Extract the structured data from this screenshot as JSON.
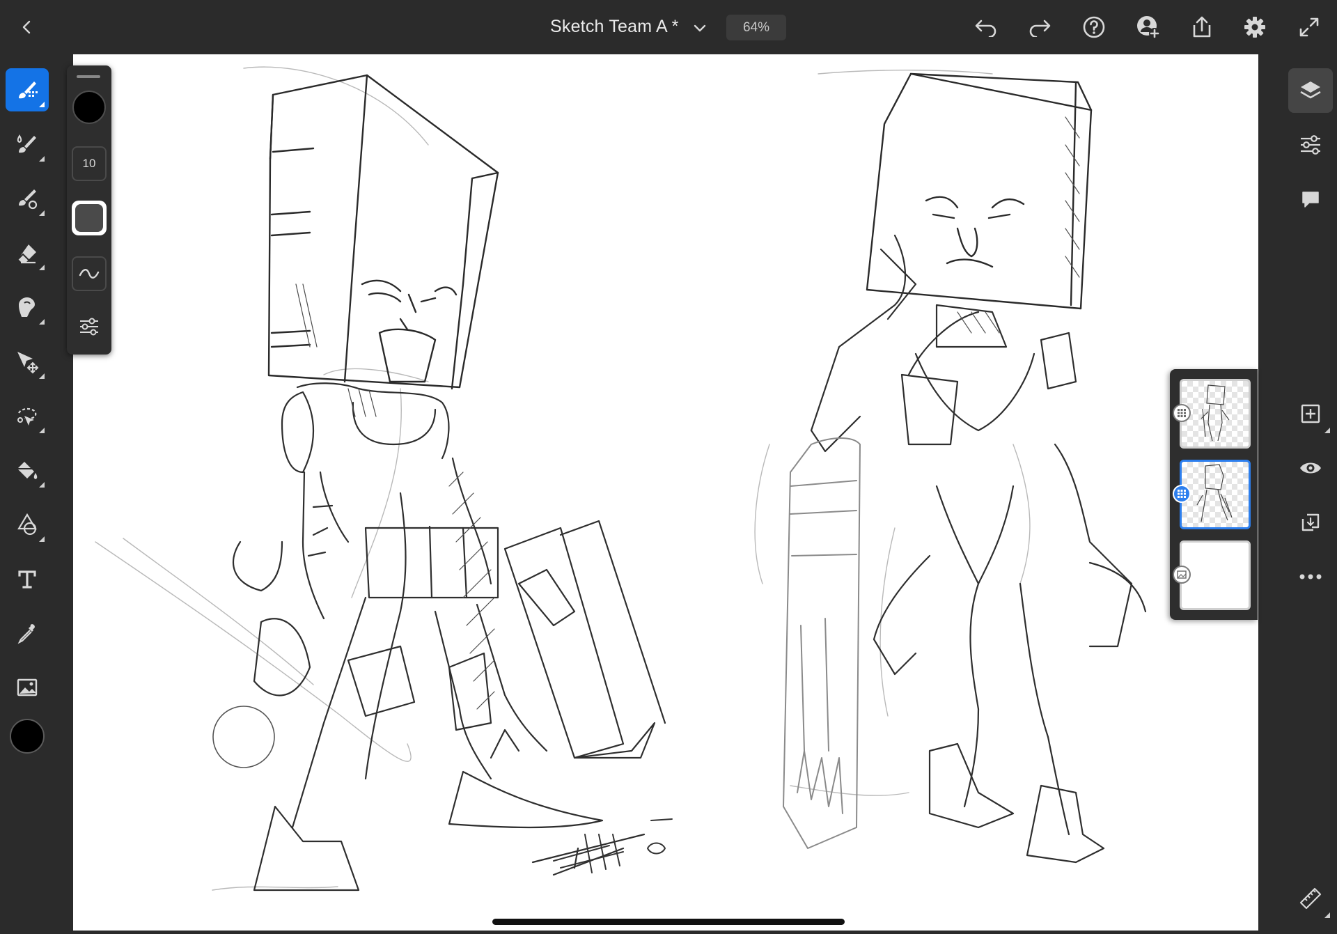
{
  "header": {
    "document_title": "Sketch Team A *",
    "zoom_level": "64%"
  },
  "brush_panel": {
    "brush_size": "10"
  },
  "tools": [
    "pixel-brush",
    "live-brush",
    "mixer-brush",
    "eraser",
    "smudge",
    "transform",
    "selection",
    "fill",
    "shape",
    "text",
    "eyedropper",
    "image"
  ],
  "right_tools": [
    "layers",
    "layer-properties",
    "comments",
    "add-layer",
    "visibility",
    "reference-layer",
    "more-options",
    "ruler"
  ],
  "layers": [
    {
      "name": "character-right-layer",
      "active": false
    },
    {
      "name": "character-left-layer",
      "active": true
    },
    {
      "name": "background-layer",
      "active": false
    }
  ],
  "colors": {
    "accent": "#1473e6",
    "current_color": "#000000",
    "panel_bg": "#2b2b2b",
    "canvas_bg": "#ffffff"
  }
}
